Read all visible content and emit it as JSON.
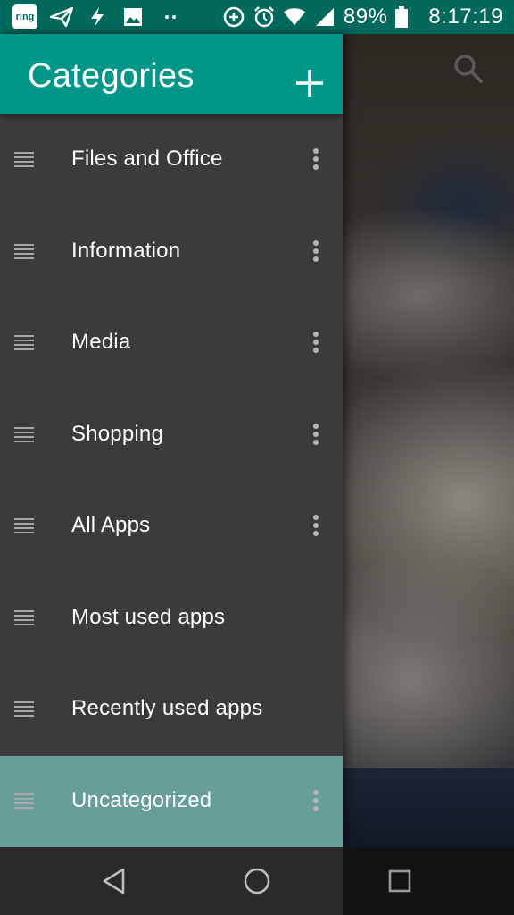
{
  "status_bar": {
    "ring_app_label": "ring",
    "battery_percent": "89%",
    "time": "8:17:19",
    "icons": [
      "ring-app-icon",
      "send-icon",
      "flash-icon",
      "image-icon",
      "dots-icon",
      "data-saver-icon",
      "alarm-icon",
      "wifi-icon",
      "cellular-signal-icon",
      "battery-icon"
    ]
  },
  "drawer": {
    "title": "Categories",
    "add_icon": "plus-icon",
    "items": [
      {
        "label": "Files and Office",
        "has_menu": true,
        "selected": false
      },
      {
        "label": "Information",
        "has_menu": true,
        "selected": false
      },
      {
        "label": "Media",
        "has_menu": true,
        "selected": false
      },
      {
        "label": "Shopping",
        "has_menu": true,
        "selected": false
      },
      {
        "label": "All Apps",
        "has_menu": true,
        "selected": false
      },
      {
        "label": "Most used apps",
        "has_menu": false,
        "selected": false
      },
      {
        "label": "Recently used apps",
        "has_menu": false,
        "selected": false
      },
      {
        "label": "Uncategorized",
        "has_menu": true,
        "selected": true
      }
    ]
  },
  "background": {
    "search_icon": "search-icon"
  },
  "navigation_bar": {
    "buttons": [
      "back-icon",
      "home-icon",
      "recents-icon"
    ]
  },
  "colors": {
    "status_bar": "#00695c",
    "header": "#009688",
    "drawer_bg": "#3b3b3b",
    "selected_item": "#679e98"
  }
}
